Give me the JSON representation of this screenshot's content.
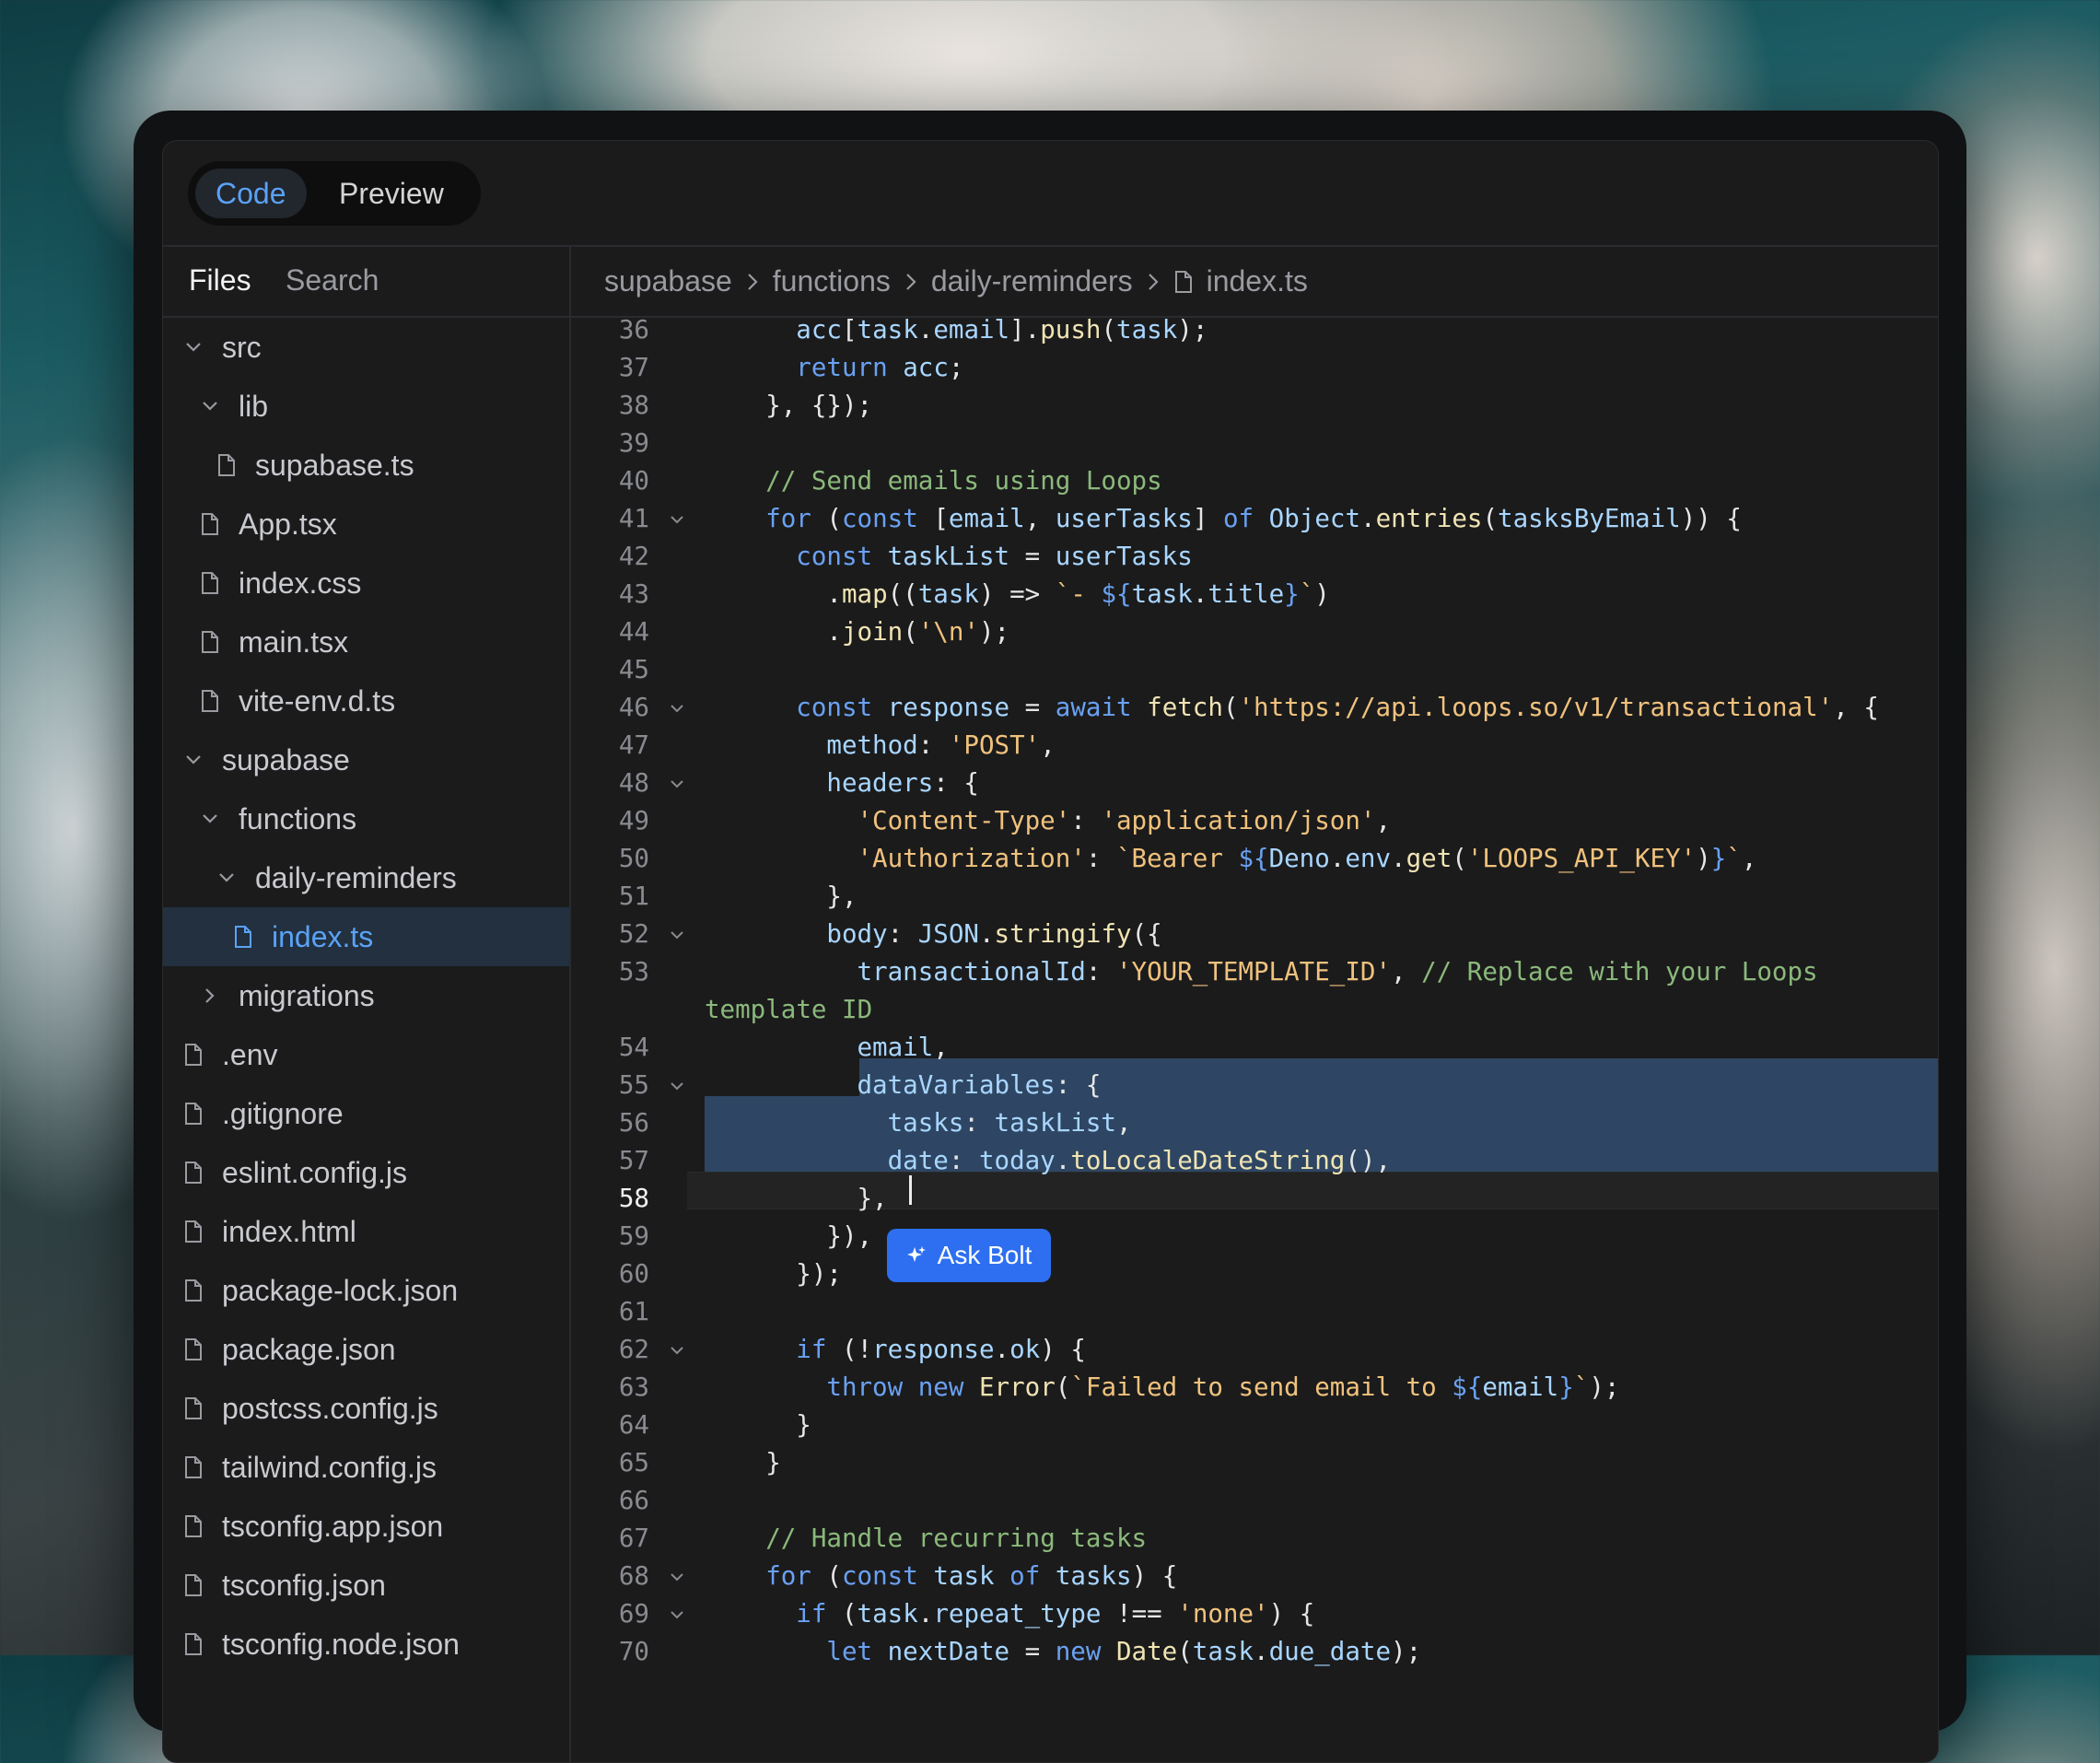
{
  "header": {
    "tabs": [
      {
        "label": "Code",
        "active": true
      },
      {
        "label": "Preview",
        "active": false
      }
    ]
  },
  "sidebar": {
    "tabs": [
      "Files",
      "Search"
    ],
    "tree": [
      {
        "label": "src",
        "type": "folder",
        "expanded": true,
        "depth": 0
      },
      {
        "label": "lib",
        "type": "folder",
        "expanded": true,
        "depth": 1
      },
      {
        "label": "supabase.ts",
        "type": "file",
        "depth": 2
      },
      {
        "label": "App.tsx",
        "type": "file",
        "depth": 1
      },
      {
        "label": "index.css",
        "type": "file",
        "depth": 1
      },
      {
        "label": "main.tsx",
        "type": "file",
        "depth": 1
      },
      {
        "label": "vite-env.d.ts",
        "type": "file",
        "depth": 1
      },
      {
        "label": "supabase",
        "type": "folder",
        "expanded": true,
        "depth": 0
      },
      {
        "label": "functions",
        "type": "folder",
        "expanded": true,
        "depth": 1
      },
      {
        "label": "daily-reminders",
        "type": "folder",
        "expanded": true,
        "depth": 2
      },
      {
        "label": "index.ts",
        "type": "file",
        "depth": 3,
        "selected": true
      },
      {
        "label": "migrations",
        "type": "folder",
        "expanded": false,
        "depth": 1
      },
      {
        "label": ".env",
        "type": "file",
        "depth": 0
      },
      {
        "label": ".gitignore",
        "type": "file",
        "depth": 0
      },
      {
        "label": "eslint.config.js",
        "type": "file",
        "depth": 0
      },
      {
        "label": "index.html",
        "type": "file",
        "depth": 0
      },
      {
        "label": "package-lock.json",
        "type": "file",
        "depth": 0
      },
      {
        "label": "package.json",
        "type": "file",
        "depth": 0
      },
      {
        "label": "postcss.config.js",
        "type": "file",
        "depth": 0
      },
      {
        "label": "tailwind.config.js",
        "type": "file",
        "depth": 0
      },
      {
        "label": "tsconfig.app.json",
        "type": "file",
        "depth": 0
      },
      {
        "label": "tsconfig.json",
        "type": "file",
        "depth": 0
      },
      {
        "label": "tsconfig.node.json",
        "type": "file",
        "depth": 0
      }
    ]
  },
  "breadcrumb": [
    "supabase",
    "functions",
    "daily-reminders",
    "index.ts"
  ],
  "editor": {
    "current_line": 58,
    "ask_button_label": "Ask Bolt",
    "lines": [
      {
        "n": "36",
        "fold": false,
        "indent": 3,
        "tokens": [
          [
            "var",
            "acc"
          ],
          [
            "pl",
            "["
          ],
          [
            "var",
            "task"
          ],
          [
            "pl",
            "."
          ],
          [
            "var",
            "email"
          ],
          [
            "pl",
            "]."
          ],
          [
            "fn",
            "push"
          ],
          [
            "pl",
            "("
          ],
          [
            "var",
            "task"
          ],
          [
            "pl",
            ");"
          ]
        ]
      },
      {
        "n": "37",
        "fold": false,
        "indent": 3,
        "tokens": [
          [
            "kw",
            "return"
          ],
          [
            "pl",
            " "
          ],
          [
            "var",
            "acc"
          ],
          [
            "pl",
            ";"
          ]
        ]
      },
      {
        "n": "38",
        "fold": false,
        "indent": 2,
        "tokens": [
          [
            "pl",
            "}, {});"
          ]
        ]
      },
      {
        "n": "39",
        "fold": false,
        "indent": 0,
        "tokens": []
      },
      {
        "n": "40",
        "fold": false,
        "indent": 2,
        "tokens": [
          [
            "cmt",
            "// Send emails using Loops"
          ]
        ]
      },
      {
        "n": "41",
        "fold": true,
        "indent": 2,
        "tokens": [
          [
            "kw",
            "for"
          ],
          [
            "pl",
            " ("
          ],
          [
            "kw",
            "const"
          ],
          [
            "pl",
            " ["
          ],
          [
            "var",
            "email"
          ],
          [
            "pl",
            ", "
          ],
          [
            "var",
            "userTasks"
          ],
          [
            "pl",
            "] "
          ],
          [
            "kw",
            "of"
          ],
          [
            "pl",
            " "
          ],
          [
            "var",
            "Object"
          ],
          [
            "pl",
            "."
          ],
          [
            "fn",
            "entries"
          ],
          [
            "pl",
            "("
          ],
          [
            "var",
            "tasksByEmail"
          ],
          [
            "pl",
            ")) {"
          ]
        ]
      },
      {
        "n": "42",
        "fold": false,
        "indent": 3,
        "tokens": [
          [
            "kw",
            "const"
          ],
          [
            "pl",
            " "
          ],
          [
            "var",
            "taskList"
          ],
          [
            "pl",
            " = "
          ],
          [
            "var",
            "userTasks"
          ]
        ]
      },
      {
        "n": "43",
        "fold": false,
        "indent": 4,
        "tokens": [
          [
            "pl",
            "."
          ],
          [
            "fn",
            "map"
          ],
          [
            "pl",
            "(("
          ],
          [
            "var",
            "task"
          ],
          [
            "pl",
            ") => "
          ],
          [
            "str",
            "`- "
          ],
          [
            "kw",
            "${"
          ],
          [
            "var",
            "task"
          ],
          [
            "pl",
            "."
          ],
          [
            "var",
            "title"
          ],
          [
            "kw",
            "}"
          ],
          [
            "str",
            "`"
          ],
          [
            "pl",
            ")"
          ]
        ]
      },
      {
        "n": "44",
        "fold": false,
        "indent": 4,
        "tokens": [
          [
            "pl",
            "."
          ],
          [
            "fn",
            "join"
          ],
          [
            "pl",
            "("
          ],
          [
            "str",
            "'\\n'"
          ],
          [
            "pl",
            ");"
          ]
        ]
      },
      {
        "n": "45",
        "fold": false,
        "indent": 0,
        "tokens": []
      },
      {
        "n": "46",
        "fold": true,
        "indent": 3,
        "tokens": [
          [
            "kw",
            "const"
          ],
          [
            "pl",
            " "
          ],
          [
            "var",
            "response"
          ],
          [
            "pl",
            " = "
          ],
          [
            "kw",
            "await"
          ],
          [
            "pl",
            " "
          ],
          [
            "fn",
            "fetch"
          ],
          [
            "pl",
            "("
          ],
          [
            "str",
            "'https://api.loops.so/v1/transactional'"
          ],
          [
            "pl",
            ", {"
          ]
        ]
      },
      {
        "n": "47",
        "fold": false,
        "indent": 4,
        "tokens": [
          [
            "var",
            "method"
          ],
          [
            "pl",
            ": "
          ],
          [
            "str",
            "'POST'"
          ],
          [
            "pl",
            ","
          ]
        ]
      },
      {
        "n": "48",
        "fold": true,
        "indent": 4,
        "tokens": [
          [
            "var",
            "headers"
          ],
          [
            "pl",
            ": {"
          ]
        ]
      },
      {
        "n": "49",
        "fold": false,
        "indent": 5,
        "tokens": [
          [
            "str",
            "'Content-Type'"
          ],
          [
            "pl",
            ": "
          ],
          [
            "str",
            "'application/json'"
          ],
          [
            "pl",
            ","
          ]
        ]
      },
      {
        "n": "50",
        "fold": false,
        "indent": 5,
        "tokens": [
          [
            "str",
            "'Authorization'"
          ],
          [
            "pl",
            ": "
          ],
          [
            "str",
            "`Bearer "
          ],
          [
            "kw",
            "${"
          ],
          [
            "var",
            "Deno"
          ],
          [
            "pl",
            "."
          ],
          [
            "var",
            "env"
          ],
          [
            "pl",
            "."
          ],
          [
            "fn",
            "get"
          ],
          [
            "pl",
            "("
          ],
          [
            "str",
            "'LOOPS_API_KEY'"
          ],
          [
            "pl",
            ")"
          ],
          [
            "kw",
            "}"
          ],
          [
            "str",
            "`"
          ],
          [
            "pl",
            ","
          ]
        ]
      },
      {
        "n": "51",
        "fold": false,
        "indent": 4,
        "tokens": [
          [
            "pl",
            "},"
          ]
        ]
      },
      {
        "n": "52",
        "fold": true,
        "indent": 4,
        "tokens": [
          [
            "var",
            "body"
          ],
          [
            "pl",
            ": "
          ],
          [
            "var",
            "JSON"
          ],
          [
            "pl",
            "."
          ],
          [
            "fn",
            "stringify"
          ],
          [
            "pl",
            "({"
          ]
        ]
      },
      {
        "n": "53",
        "fold": false,
        "indent": 5,
        "tokens": [
          [
            "var",
            "transactionalId"
          ],
          [
            "pl",
            ": "
          ],
          [
            "str",
            "'YOUR_TEMPLATE_ID'"
          ],
          [
            "pl",
            ", "
          ],
          [
            "cmt",
            "// Replace with your Loops"
          ]
        ]
      },
      {
        "n": "",
        "fold": false,
        "indent": 0,
        "tokens": [
          [
            "cmt",
            "template ID"
          ]
        ]
      },
      {
        "n": "54",
        "fold": false,
        "indent": 5,
        "tokens": [
          [
            "var",
            "email"
          ],
          [
            "pl",
            ","
          ]
        ]
      },
      {
        "n": "55",
        "fold": true,
        "indent": 5,
        "tokens": [
          [
            "var",
            "dataVariables"
          ],
          [
            "pl",
            ": {"
          ]
        ]
      },
      {
        "n": "56",
        "fold": false,
        "indent": 6,
        "tokens": [
          [
            "var",
            "tasks"
          ],
          [
            "pl",
            ": "
          ],
          [
            "var",
            "taskList"
          ],
          [
            "pl",
            ","
          ]
        ]
      },
      {
        "n": "57",
        "fold": false,
        "indent": 6,
        "tokens": [
          [
            "var",
            "date"
          ],
          [
            "pl",
            ": "
          ],
          [
            "var",
            "today"
          ],
          [
            "pl",
            "."
          ],
          [
            "fn",
            "toLocaleDateString"
          ],
          [
            "pl",
            "(),"
          ]
        ]
      },
      {
        "n": "58",
        "fold": false,
        "indent": 5,
        "tokens": [
          [
            "pl",
            "},"
          ]
        ]
      },
      {
        "n": "59",
        "fold": false,
        "indent": 4,
        "tokens": [
          [
            "pl",
            "}),"
          ]
        ]
      },
      {
        "n": "60",
        "fold": false,
        "indent": 3,
        "tokens": [
          [
            "pl",
            "});"
          ]
        ]
      },
      {
        "n": "61",
        "fold": false,
        "indent": 0,
        "tokens": []
      },
      {
        "n": "62",
        "fold": true,
        "indent": 3,
        "tokens": [
          [
            "kw",
            "if"
          ],
          [
            "pl",
            " (!"
          ],
          [
            "var",
            "response"
          ],
          [
            "pl",
            "."
          ],
          [
            "var",
            "ok"
          ],
          [
            "pl",
            ") {"
          ]
        ]
      },
      {
        "n": "63",
        "fold": false,
        "indent": 4,
        "tokens": [
          [
            "kw",
            "throw"
          ],
          [
            "pl",
            " "
          ],
          [
            "kw",
            "new"
          ],
          [
            "pl",
            " "
          ],
          [
            "fn",
            "Error"
          ],
          [
            "pl",
            "("
          ],
          [
            "str",
            "`Failed to send email to "
          ],
          [
            "kw",
            "${"
          ],
          [
            "var",
            "email"
          ],
          [
            "kw",
            "}"
          ],
          [
            "str",
            "`"
          ],
          [
            "pl",
            ");"
          ]
        ]
      },
      {
        "n": "64",
        "fold": false,
        "indent": 3,
        "tokens": [
          [
            "pl",
            "}"
          ]
        ]
      },
      {
        "n": "65",
        "fold": false,
        "indent": 2,
        "tokens": [
          [
            "pl",
            "}"
          ]
        ]
      },
      {
        "n": "66",
        "fold": false,
        "indent": 0,
        "tokens": []
      },
      {
        "n": "67",
        "fold": false,
        "indent": 2,
        "tokens": [
          [
            "cmt",
            "// Handle recurring tasks"
          ]
        ]
      },
      {
        "n": "68",
        "fold": true,
        "indent": 2,
        "tokens": [
          [
            "kw",
            "for"
          ],
          [
            "pl",
            " ("
          ],
          [
            "kw",
            "const"
          ],
          [
            "pl",
            " "
          ],
          [
            "var",
            "task"
          ],
          [
            "pl",
            " "
          ],
          [
            "kw",
            "of"
          ],
          [
            "pl",
            " "
          ],
          [
            "var",
            "tasks"
          ],
          [
            "pl",
            ") {"
          ]
        ]
      },
      {
        "n": "69",
        "fold": true,
        "indent": 3,
        "tokens": [
          [
            "kw",
            "if"
          ],
          [
            "pl",
            " ("
          ],
          [
            "var",
            "task"
          ],
          [
            "pl",
            "."
          ],
          [
            "var",
            "repeat_type"
          ],
          [
            "pl",
            " !== "
          ],
          [
            "str",
            "'none'"
          ],
          [
            "pl",
            ") {"
          ]
        ]
      },
      {
        "n": "70",
        "fold": false,
        "indent": 4,
        "tokens": [
          [
            "kw",
            "let"
          ],
          [
            "pl",
            " "
          ],
          [
            "var",
            "nextDate"
          ],
          [
            "pl",
            " = "
          ],
          [
            "kw",
            "new"
          ],
          [
            "pl",
            " "
          ],
          [
            "fn",
            "Date"
          ],
          [
            "pl",
            "("
          ],
          [
            "var",
            "task"
          ],
          [
            "pl",
            "."
          ],
          [
            "var",
            "due_date"
          ],
          [
            "pl",
            ");"
          ]
        ]
      }
    ]
  },
  "colors": {
    "accent": "#5aa2f7",
    "selection": "#2e4663",
    "ask_button": "#2d6ff0",
    "keyword": "#6aa1f2",
    "string": "#f0c27d",
    "comment": "#8bb97b"
  }
}
